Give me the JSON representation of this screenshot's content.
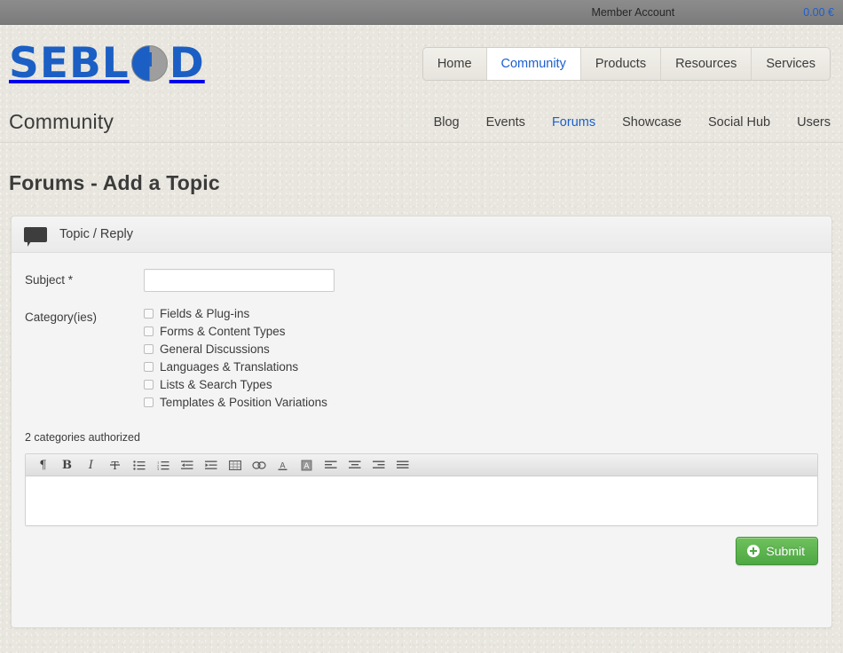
{
  "topbar": {
    "member_account": "Member Account",
    "cart_total": "0.00 €",
    "link_color": "#1b5fd0"
  },
  "brand": {
    "logo_text_left": "SEBL",
    "logo_text_right": "D",
    "logo_globe_icon": "puzzle-globe-icon",
    "logo_color": "#1b5fc4"
  },
  "mainnav": {
    "items": [
      {
        "label": "Home",
        "active": false
      },
      {
        "label": "Community",
        "active": true
      },
      {
        "label": "Products",
        "active": false
      },
      {
        "label": "Resources",
        "active": false
      },
      {
        "label": "Services",
        "active": false
      }
    ]
  },
  "section": {
    "title": "Community",
    "subnav": [
      {
        "label": "Blog",
        "active": false
      },
      {
        "label": "Events",
        "active": false
      },
      {
        "label": "Forums",
        "active": true
      },
      {
        "label": "Showcase",
        "active": false
      },
      {
        "label": "Social Hub",
        "active": false
      },
      {
        "label": "Users",
        "active": false
      }
    ]
  },
  "page": {
    "title": "Forums - Add a Topic"
  },
  "panel": {
    "icon": "comment-bubble-icon",
    "title": "Topic / Reply",
    "subject": {
      "label": "Subject *",
      "value": "",
      "placeholder": ""
    },
    "categories": {
      "label": "Category(ies)",
      "options": [
        {
          "label": "Fields & Plug-ins",
          "checked": false
        },
        {
          "label": "Forms & Content Types",
          "checked": false
        },
        {
          "label": "General Discussions",
          "checked": false
        },
        {
          "label": "Languages & Translations",
          "checked": false
        },
        {
          "label": "Lists & Search Types",
          "checked": false
        },
        {
          "label": "Templates & Position Variations",
          "checked": false
        }
      ],
      "note": "2 categories authorized"
    },
    "editor": {
      "content": "",
      "toolbar": [
        {
          "name": "paragraph-format-icon",
          "glyph": "¶"
        },
        {
          "name": "bold-icon",
          "glyph": "B"
        },
        {
          "name": "italic-icon",
          "glyph": "I"
        },
        {
          "name": "remove-format-icon",
          "glyph": "T"
        },
        {
          "name": "bullet-list-icon",
          "glyph": ""
        },
        {
          "name": "numbered-list-icon",
          "glyph": ""
        },
        {
          "name": "outdent-icon",
          "glyph": ""
        },
        {
          "name": "indent-icon",
          "glyph": ""
        },
        {
          "name": "table-icon",
          "glyph": ""
        },
        {
          "name": "link-icon",
          "glyph": ""
        },
        {
          "name": "text-color-icon",
          "glyph": "A"
        },
        {
          "name": "highlight-color-icon",
          "glyph": "A"
        },
        {
          "name": "align-left-icon",
          "glyph": ""
        },
        {
          "name": "align-center-icon",
          "glyph": ""
        },
        {
          "name": "align-right-icon",
          "glyph": ""
        },
        {
          "name": "align-justify-icon",
          "glyph": ""
        }
      ]
    },
    "submit": {
      "label": "Submit",
      "icon": "plus-circle-icon",
      "color": "#4da843"
    }
  }
}
